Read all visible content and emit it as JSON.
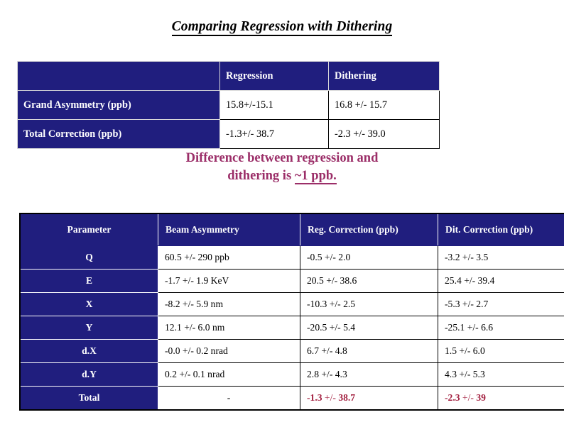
{
  "slide": {
    "title": "Comparing Regression with Dithering",
    "navy_color": "#201E7E",
    "accent_purple": "#9B2E68",
    "accent_red": "#A32040"
  },
  "summary_table": {
    "headers": [
      "",
      "Regression",
      "Dithering"
    ],
    "rows": [
      {
        "label": "Grand Asymmetry (ppb)",
        "regression": "15.8+/-15.1",
        "dithering": "16.8 +/- 15.7"
      },
      {
        "label": "Total Correction (ppb)",
        "regression": "-1.3+/- 38.7",
        "dithering": "-2.3 +/- 39.0"
      }
    ]
  },
  "note": {
    "line1": "Difference between regression and",
    "line2_prefix": "dithering is ",
    "line2_underlined": "~1 ppb."
  },
  "detail_table": {
    "headers": [
      "Parameter",
      "Beam Asymmetry",
      "Reg. Correction (ppb)",
      "Dit. Correction (ppb)"
    ],
    "rows": [
      {
        "parameter": "Q",
        "beam_asymmetry": "60.5 +/- 290 ppb",
        "reg_correction": "-0.5 +/- 2.0",
        "dit_correction": "-3.2 +/- 3.5"
      },
      {
        "parameter": "E",
        "beam_asymmetry": "-1.7 +/- 1.9 KeV",
        "reg_correction": "20.5 +/- 38.6",
        "dit_correction": "25.4 +/- 39.4"
      },
      {
        "parameter": "X",
        "beam_asymmetry": "-8.2 +/- 5.9 nm",
        "reg_correction": "-10.3 +/- 2.5",
        "dit_correction": "-5.3 +/- 2.7"
      },
      {
        "parameter": "Y",
        "beam_asymmetry": "12.1 +/- 6.0 nm",
        "reg_correction": "-20.5 +/- 5.4",
        "dit_correction": "-25.1 +/- 6.6"
      },
      {
        "parameter": "d.X",
        "beam_asymmetry": "-0.0 +/- 0.2 nrad",
        "reg_correction": "6.7 +/- 4.8",
        "dit_correction": "1.5 +/- 6.0"
      },
      {
        "parameter": "d.Y",
        "beam_asymmetry": "0.2 +/- 0.1 nrad",
        "reg_correction": "2.8 +/- 4.3",
        "dit_correction": "4.3 +/- 5.3"
      }
    ],
    "total_row": {
      "parameter": "Total",
      "beam_asymmetry": "-",
      "reg_correction_value1": "-1.3",
      "reg_correction_sep": " +/- ",
      "reg_correction_value2": "38.7",
      "dit_correction_value1": "-2.3",
      "dit_correction_sep": " +/- ",
      "dit_correction_value2": "39"
    }
  }
}
